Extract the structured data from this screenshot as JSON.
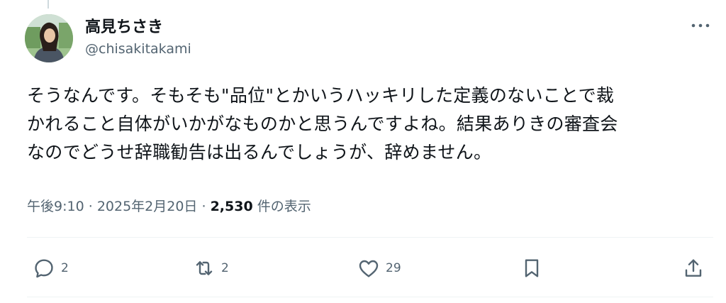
{
  "author": {
    "display_name": "高見ちさき",
    "handle": "@chisakitakami"
  },
  "post": {
    "text": "そうなんです。そもそも\"品位\"とかいうハッキリした定義のないことで裁\nかれること自体がいかがなものかと思うんですよね。結果ありきの審査会\nなのでどうせ辞職勧告は出るんでしょうが、辞めません。",
    "time": "午後9:10",
    "date": "2025年2月20日",
    "separator": "·",
    "views_count": "2,530",
    "views_label": "件の表示"
  },
  "actions": {
    "reply_count": "2",
    "repost_count": "2",
    "like_count": "29"
  },
  "icons": {
    "more": "more-dots-icon",
    "reply": "reply-icon",
    "repost": "repost-icon",
    "like": "heart-icon",
    "bookmark": "bookmark-icon",
    "share": "share-icon"
  },
  "colors": {
    "text": "#0f1419",
    "secondary": "#536471",
    "divider": "#eff3f4"
  }
}
